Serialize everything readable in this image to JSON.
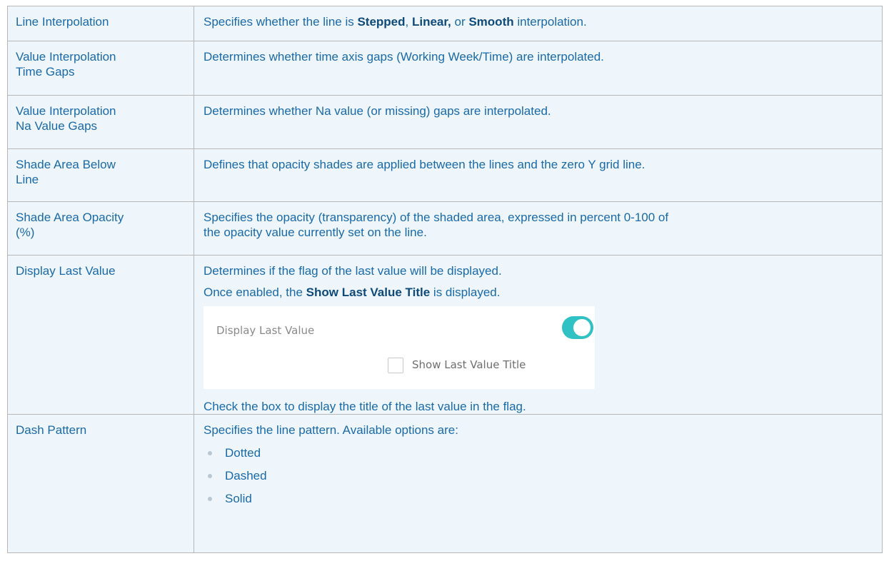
{
  "rows": [
    {
      "name": "Line Interpolation",
      "desc_pre": "Specifies whether the line is ",
      "kw1": "Stepped",
      "sep1": ", ",
      "kw2": "Linear,",
      "sep2": " or ",
      "kw3": "Smooth",
      "desc_post": " interpolation."
    },
    {
      "name_l1": "Value Interpolation",
      "name_l2": "Time Gaps",
      "desc": "Determines whether time axis gaps (Working Week/Time) are interpolated."
    },
    {
      "name_l1": "Value Interpolation",
      "name_l2": "Na Value Gaps",
      "desc": "Determines whether Na value (or missing) gaps are interpolated."
    },
    {
      "name_l1": "Shade Area Below",
      "name_l2": "Line",
      "desc": "Defines that opacity shades are applied between the lines and the zero Y grid line."
    },
    {
      "name_l1": "Shade Area Opacity",
      "name_l2": "(%)",
      "desc_l1": "Specifies the opacity (transparency) of the shaded area, expressed in percent 0-100 of",
      "desc_l2": "the opacity value currently set on the line."
    },
    {
      "name": "Display Last Value",
      "desc1": "Determines if the flag of the last value will be displayed.",
      "desc2_pre": "Once enabled, the ",
      "desc2_kw": "Show Last Value Title",
      "desc2_post": " is displayed.",
      "shot": {
        "label": "Display Last Value",
        "toggle_on": true,
        "toggle_color": "#2fc1c4",
        "checkbox_label": "Show Last Value Title",
        "checkbox_checked": false
      },
      "desc3": "Check the box to display the title of the last value in the flag."
    },
    {
      "name": "Dash Pattern",
      "desc": "Specifies the line pattern. Available options are:",
      "options": [
        "Dotted",
        "Dashed",
        "Solid"
      ]
    }
  ],
  "colors": {
    "text": "#1a6aa8",
    "keyword": "#0e4a7a",
    "cell_bg": "#eef5fb",
    "border": "#b7b7b7"
  }
}
